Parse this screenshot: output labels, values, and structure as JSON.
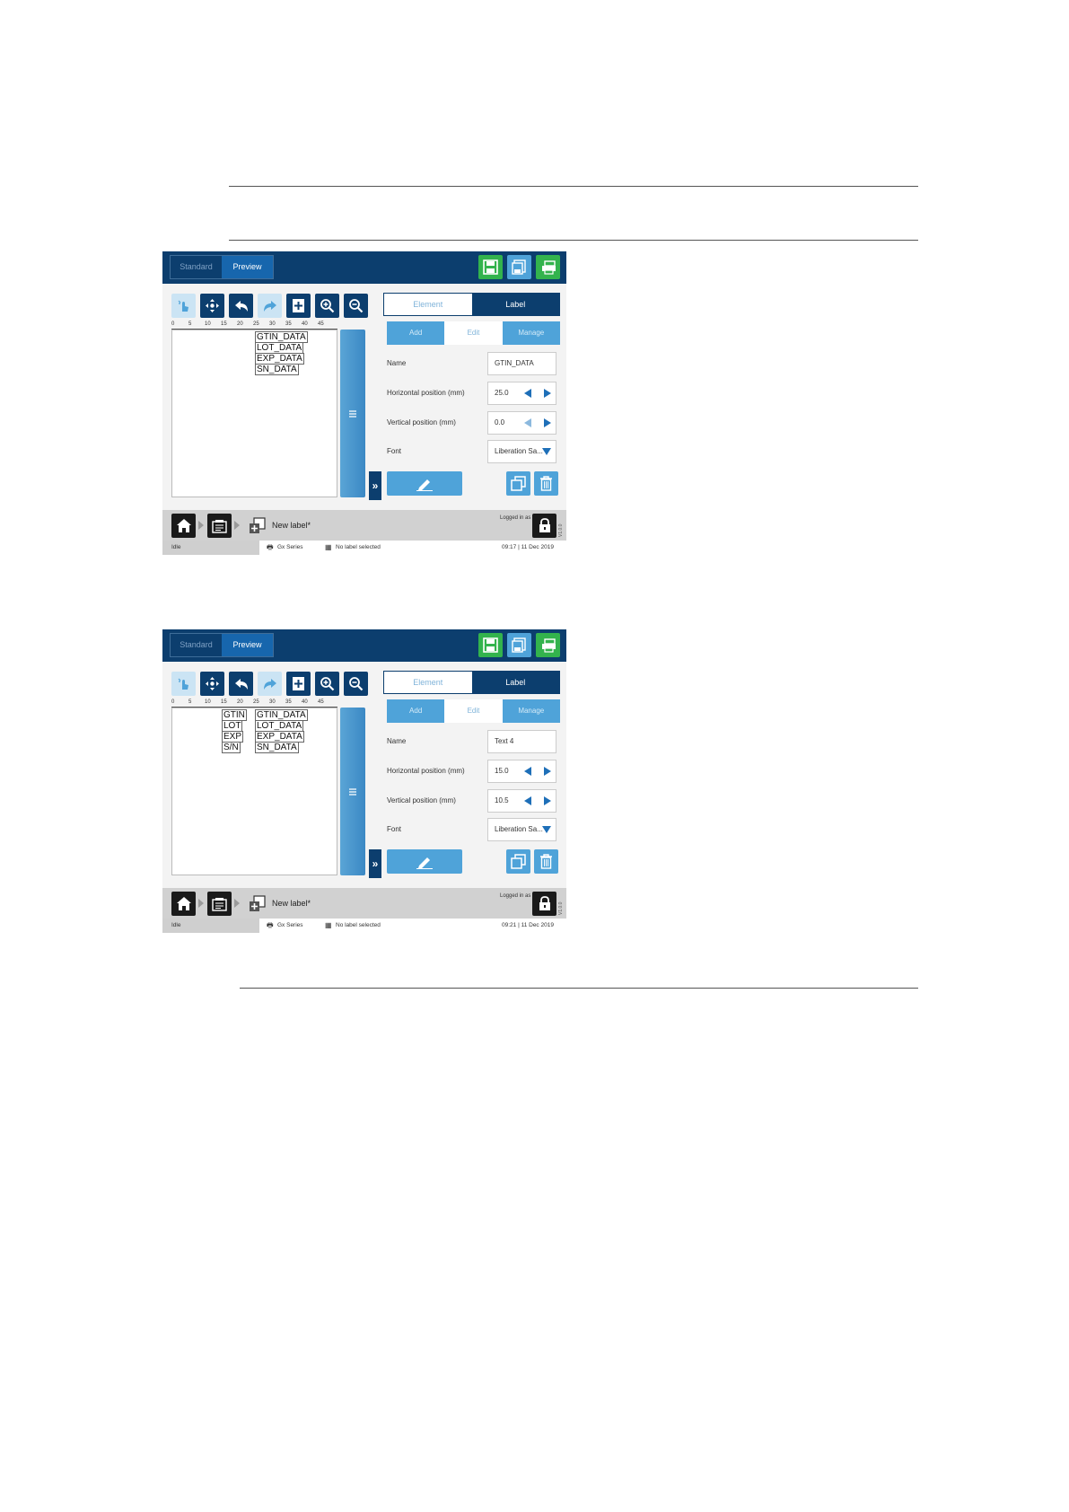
{
  "screens": [
    {
      "mode_tabs": {
        "standard": "Standard",
        "preview": "Preview"
      },
      "panel_tabs": {
        "element": "Element",
        "label": "Label"
      },
      "sub_tabs": {
        "add": "Add",
        "edit": "Edit",
        "manage": "Manage"
      },
      "ruler_ticks": [
        "0",
        "5",
        "10",
        "15",
        "20",
        "25",
        "30",
        "35",
        "40",
        "45"
      ],
      "canvas_labels": [
        "GTIN_DATA",
        "LOT_DATA",
        "EXP_DATA",
        "SN_DATA"
      ],
      "properties": {
        "name_label": "Name",
        "name_value": "GTIN_DATA",
        "hpos_label": "Horizontal position (mm)",
        "hpos_value": "25.0",
        "vpos_label": "Vertical position (mm)",
        "vpos_value": "0.0",
        "font_label": "Font",
        "font_value": "Liberation Sa..."
      },
      "bottom": {
        "label_name": "New label*",
        "logged_in": "Logged in as",
        "version": "V1.0.0"
      },
      "status": {
        "state": "Idle",
        "printer": "Gx Series",
        "label": "No label selected",
        "time": "09:17 | 11 Dec 2019"
      }
    },
    {
      "mode_tabs": {
        "standard": "Standard",
        "preview": "Preview"
      },
      "panel_tabs": {
        "element": "Element",
        "label": "Label"
      },
      "sub_tabs": {
        "add": "Add",
        "edit": "Edit",
        "manage": "Manage"
      },
      "ruler_ticks": [
        "0",
        "5",
        "10",
        "15",
        "20",
        "25",
        "30",
        "35",
        "40",
        "45"
      ],
      "canvas_prefixes": [
        "GTIN",
        "LOT",
        "EXP",
        "S/N"
      ],
      "canvas_labels": [
        "GTIN_DATA",
        "LOT_DATA",
        "EXP_DATA",
        "SN_DATA"
      ],
      "properties": {
        "name_label": "Name",
        "name_value": "Text 4",
        "hpos_label": "Horizontal position (mm)",
        "hpos_value": "15.0",
        "vpos_label": "Vertical position (mm)",
        "vpos_value": "10.5",
        "font_label": "Font",
        "font_value": "Liberation Sa..."
      },
      "bottom": {
        "label_name": "New label*",
        "logged_in": "Logged in as",
        "version": "V1.0.0"
      },
      "status": {
        "state": "Idle",
        "printer": "Gx Series",
        "label": "No label selected",
        "time": "09:21 | 11 Dec 2019"
      }
    }
  ],
  "colors": {
    "header": "#0c3e6e",
    "accent": "#4fa3d9",
    "save_green": "#33b34d"
  }
}
